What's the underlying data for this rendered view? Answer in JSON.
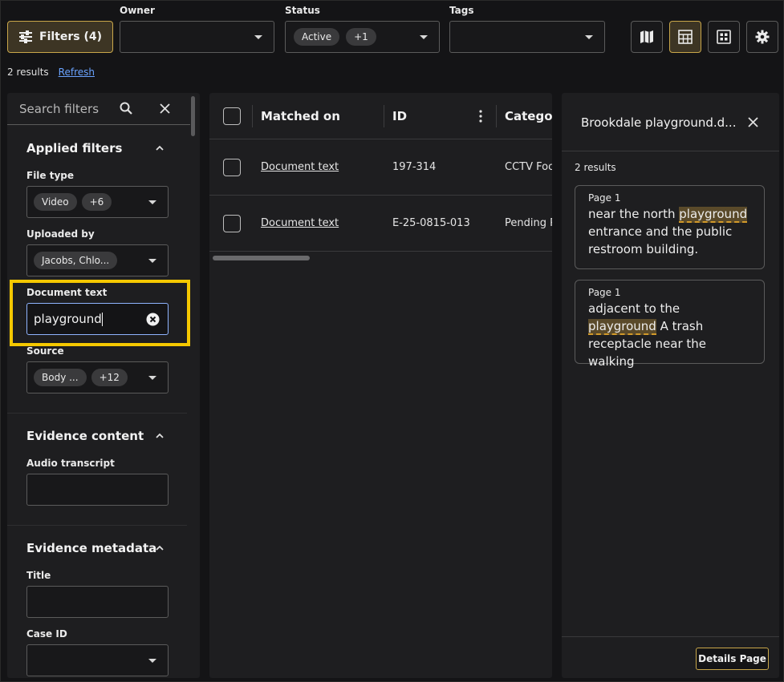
{
  "toolbar": {
    "filters_label": "Filters (4)",
    "owner_label": "Owner",
    "status_label": "Status",
    "status_chip": "Active",
    "status_more": "+1",
    "tags_label": "Tags"
  },
  "results": {
    "count_text": "2 results",
    "refresh_label": "Refresh"
  },
  "filters_panel": {
    "search_placeholder": "Search filters",
    "applied_title": "Applied filters",
    "file_type_label": "File type",
    "file_type_chip": "Video",
    "file_type_more": "+6",
    "uploaded_by_label": "Uploaded by",
    "uploaded_by_chip": "Jacobs, Chlo...",
    "document_text_label": "Document text",
    "document_text_value": "playground",
    "source_label": "Source",
    "source_chip": "Body ...",
    "source_more": "+12",
    "evidence_content_title": "Evidence content",
    "audio_transcript_label": "Audio transcript",
    "evidence_metadata_title": "Evidence metadata",
    "title_label": "Title",
    "case_id_label": "Case ID"
  },
  "table": {
    "columns": [
      "Matched on",
      "ID",
      "Category"
    ],
    "rows": [
      {
        "matched_on": "Document text",
        "id": "197-314",
        "category": "CCTV Footage"
      },
      {
        "matched_on": "Document text",
        "id": "E-25-0815-013",
        "category": "Pending Review"
      }
    ]
  },
  "preview": {
    "title": "Brookdale playground.d...",
    "results_text": "2 results",
    "cards": [
      {
        "page": "Page 1",
        "before": "near the north ",
        "match": "playground",
        "after": " entrance and the public restroom building."
      },
      {
        "page": "Page 1",
        "before": "adjacent to the ",
        "match": "playground",
        "after": " A trash receptacle near the walking"
      }
    ],
    "details_label": "Details Page"
  },
  "colors": {
    "accent": "#c9a74a",
    "highlight_frame": "#f5c800",
    "link": "#6aa3ff"
  }
}
